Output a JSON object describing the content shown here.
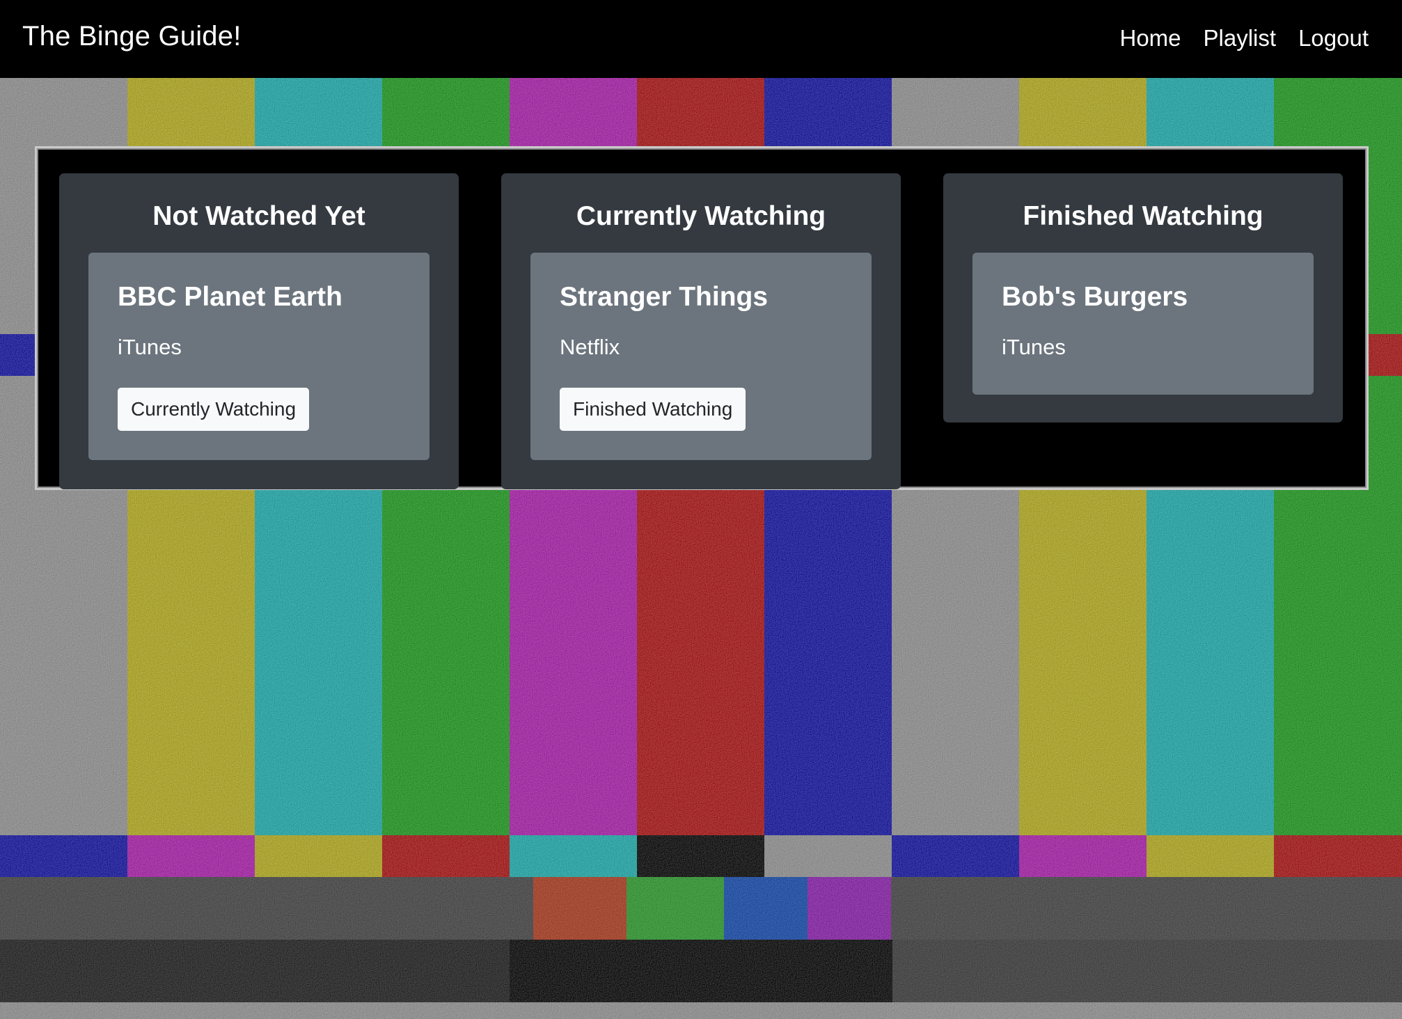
{
  "navbar": {
    "brand": "The Binge Guide!",
    "links": [
      "Home",
      "Playlist",
      "Logout"
    ]
  },
  "board": {
    "columns": [
      {
        "title": "Not Watched Yet",
        "cards": [
          {
            "title": "BBC Planet Earth",
            "service": "iTunes",
            "action": "Currently Watching"
          }
        ]
      },
      {
        "title": "Currently Watching",
        "cards": [
          {
            "title": "Stranger Things",
            "service": "Netflix",
            "action": "Finished Watching"
          }
        ]
      },
      {
        "title": "Finished Watching",
        "cards": [
          {
            "title": "Bob's Burgers",
            "service": "iTunes"
          }
        ]
      }
    ]
  },
  "colors": {
    "navbar": "#000000",
    "column_bg": "#343a40",
    "card_bg": "#6c757d",
    "button_bg": "#f8f9fa",
    "board_border": "#c9c9c9"
  },
  "background": {
    "pattern": "tv-test-pattern-static-color-bars",
    "bar_colors": [
      "#a8a8a8",
      "#c8c030",
      "#30c0c0",
      "#30b030",
      "#c030c0",
      "#c02020",
      "#2020b8"
    ]
  }
}
